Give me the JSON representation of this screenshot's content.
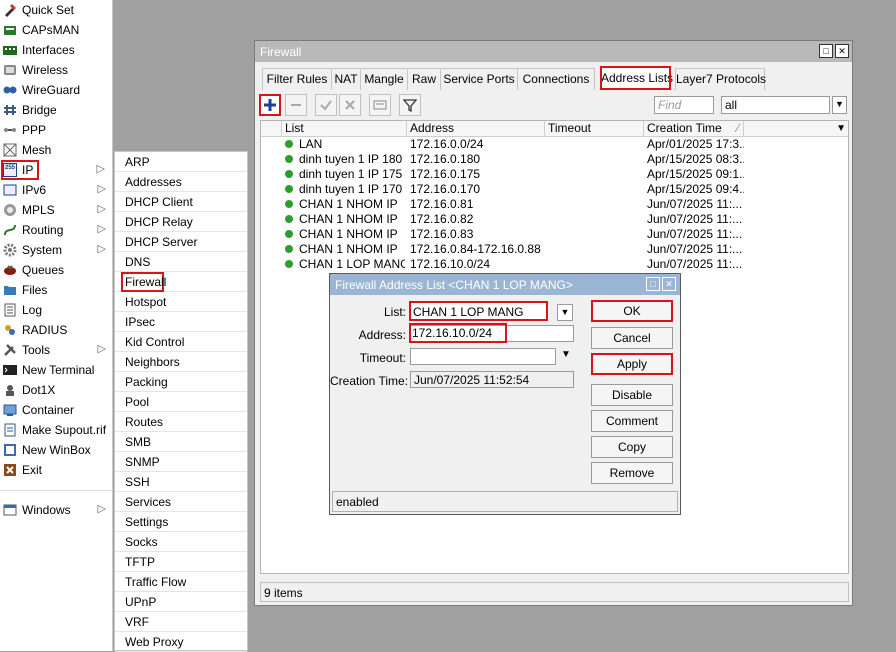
{
  "sidebar": {
    "items": [
      {
        "label": "Quick Set",
        "icon": "quick-set-icon",
        "arrow": false
      },
      {
        "label": "CAPsMAN",
        "icon": "capsman-icon",
        "arrow": false
      },
      {
        "label": "Interfaces",
        "icon": "interfaces-icon",
        "arrow": false
      },
      {
        "label": "Wireless",
        "icon": "wireless-icon",
        "arrow": false
      },
      {
        "label": "WireGuard",
        "icon": "wireguard-icon",
        "arrow": false
      },
      {
        "label": "Bridge",
        "icon": "bridge-icon",
        "arrow": false
      },
      {
        "label": "PPP",
        "icon": "ppp-icon",
        "arrow": false
      },
      {
        "label": "Mesh",
        "icon": "mesh-icon",
        "arrow": false
      },
      {
        "label": "IP",
        "icon": "ip-icon",
        "arrow": true
      },
      {
        "label": "IPv6",
        "icon": "ipv6-icon",
        "arrow": true
      },
      {
        "label": "MPLS",
        "icon": "mpls-icon",
        "arrow": true
      },
      {
        "label": "Routing",
        "icon": "routing-icon",
        "arrow": true
      },
      {
        "label": "System",
        "icon": "system-icon",
        "arrow": true
      },
      {
        "label": "Queues",
        "icon": "queues-icon",
        "arrow": false
      },
      {
        "label": "Files",
        "icon": "files-icon",
        "arrow": false
      },
      {
        "label": "Log",
        "icon": "log-icon",
        "arrow": false
      },
      {
        "label": "RADIUS",
        "icon": "radius-icon",
        "arrow": false
      },
      {
        "label": "Tools",
        "icon": "tools-icon",
        "arrow": true
      },
      {
        "label": "New Terminal",
        "icon": "terminal-icon",
        "arrow": false
      },
      {
        "label": "Dot1X",
        "icon": "dot1x-icon",
        "arrow": false
      },
      {
        "label": "Container",
        "icon": "container-icon",
        "arrow": false
      },
      {
        "label": "Make Supout.rif",
        "icon": "supout-icon",
        "arrow": false
      },
      {
        "label": "New WinBox",
        "icon": "winbox-icon",
        "arrow": false
      },
      {
        "label": "Exit",
        "icon": "exit-icon",
        "arrow": false
      },
      {
        "label": "Windows",
        "icon": "windows-icon",
        "arrow": true
      }
    ],
    "ip_icon_text": "255"
  },
  "submenu": {
    "items": [
      "ARP",
      "Addresses",
      "DHCP Client",
      "DHCP Relay",
      "DHCP Server",
      "DNS",
      "Firewall",
      "Hotspot",
      "IPsec",
      "Kid Control",
      "Neighbors",
      "Packing",
      "Pool",
      "Routes",
      "SMB",
      "SNMP",
      "SSH",
      "Services",
      "Settings",
      "Socks",
      "TFTP",
      "Traffic Flow",
      "UPnP",
      "VRF",
      "Web Proxy"
    ]
  },
  "firewall": {
    "title": "Firewall",
    "tabs": [
      "Filter Rules",
      "NAT",
      "Mangle",
      "Raw",
      "Service Ports",
      "Connections",
      "Address Lists",
      "Layer7 Protocols"
    ],
    "find_placeholder": "Find",
    "filter_value": "all",
    "columns": [
      "List",
      "Address",
      "Timeout",
      "Creation Time"
    ],
    "rows": [
      {
        "list": "LAN",
        "address": "172.16.0.0/24",
        "timeout": "",
        "created": "Apr/01/2025 17:3..."
      },
      {
        "list": "dinh tuyen 1 IP 180",
        "address": "172.16.0.180",
        "timeout": "",
        "created": "Apr/15/2025 08:3..."
      },
      {
        "list": "dinh tuyen 1 IP 175",
        "address": "172.16.0.175",
        "timeout": "",
        "created": "Apr/15/2025 09:1..."
      },
      {
        "list": "dinh tuyen 1 IP 170",
        "address": "172.16.0.170",
        "timeout": "",
        "created": "Apr/15/2025 09:4..."
      },
      {
        "list": "CHAN 1 NHOM IP",
        "address": "172.16.0.81",
        "timeout": "",
        "created": "Jun/07/2025 11:..."
      },
      {
        "list": "CHAN 1 NHOM IP",
        "address": "172.16.0.82",
        "timeout": "",
        "created": "Jun/07/2025 11:..."
      },
      {
        "list": "CHAN 1 NHOM IP",
        "address": "172.16.0.83",
        "timeout": "",
        "created": "Jun/07/2025 11:..."
      },
      {
        "list": "CHAN 1 NHOM IP",
        "address": "172.16.0.84-172.16.0.88",
        "timeout": "",
        "created": "Jun/07/2025 11:..."
      },
      {
        "list": "CHAN 1 LOP MANG",
        "address": "172.16.10.0/24",
        "timeout": "",
        "created": "Jun/07/2025 11:..."
      }
    ],
    "status": "9 items"
  },
  "dialog": {
    "title": "Firewall Address List <CHAN 1 LOP MANG>",
    "list_label": "List:",
    "list_value": "CHAN 1 LOP MANG",
    "address_label": "Address:",
    "address_value": "172.16.10.0/24",
    "timeout_label": "Timeout:",
    "timeout_value": "",
    "creation_label": "Creation Time:",
    "creation_value": "Jun/07/2025 11:52:54",
    "buttons": [
      "OK",
      "Cancel",
      "Apply",
      "Disable",
      "Comment",
      "Copy",
      "Remove"
    ],
    "status": "enabled"
  },
  "colors": {
    "highlight": "#d9131b",
    "active_dot": "#2d9e2d",
    "dialog_title": "#9bb6d4",
    "window_title": "#b9b9b9"
  }
}
